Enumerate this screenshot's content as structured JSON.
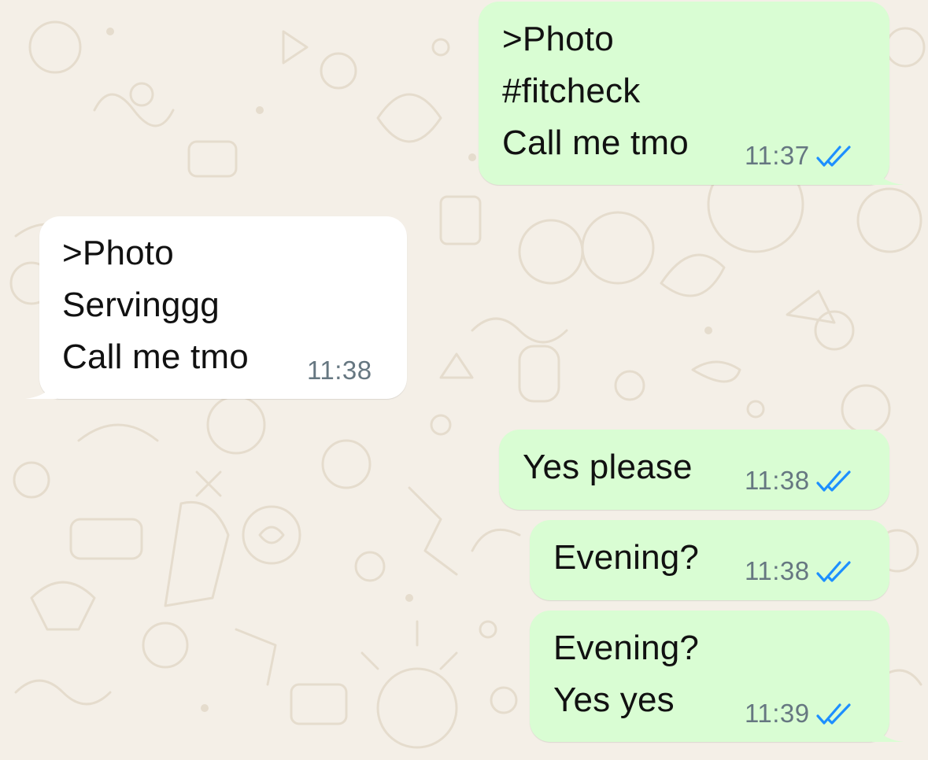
{
  "colors": {
    "outgoing_bubble": "#d9fdd3",
    "incoming_bubble": "#ffffff",
    "wallpaper": "#f4efe7",
    "time_text": "#667781",
    "read_ticks": "#1d8fff"
  },
  "messages": [
    {
      "direction": "outgoing",
      "lines": [
        ">Photo",
        "#fitcheck",
        "Call me tmo"
      ],
      "time": "11:37",
      "status": "read-double-tick-icon"
    },
    {
      "direction": "incoming",
      "lines": [
        ">Photo",
        "Servinggg",
        "Call me tmo"
      ],
      "time": "11:38"
    },
    {
      "direction": "outgoing",
      "lines": [
        "Yes please"
      ],
      "time": "11:38",
      "status": "read-double-tick-icon"
    },
    {
      "direction": "outgoing",
      "lines": [
        "Evening?"
      ],
      "time": "11:38",
      "status": "read-double-tick-icon"
    },
    {
      "direction": "outgoing",
      "lines": [
        "Evening?",
        "Yes yes"
      ],
      "time": "11:39",
      "status": "read-double-tick-icon"
    }
  ]
}
